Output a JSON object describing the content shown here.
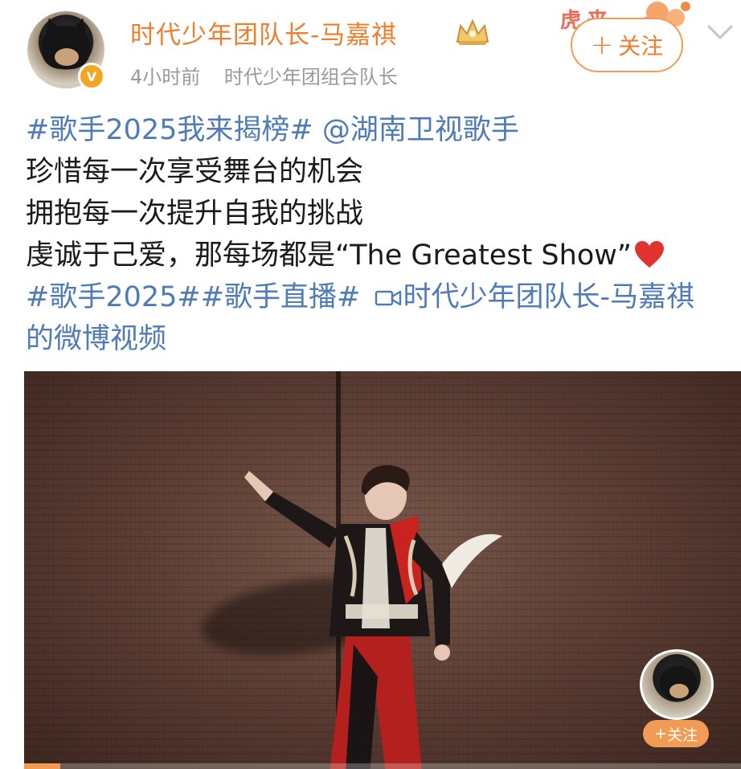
{
  "post": {
    "author": {
      "name": "时代少年团队长-马嘉祺",
      "verified": true
    },
    "meta": {
      "time": "4小时前",
      "title": "时代少年团组合队长"
    },
    "follow_label": "关注",
    "content": {
      "line1": {
        "hashtag": "#歌手2025我来揭榜#",
        "mention": "@湖南卫视歌手"
      },
      "line2": "珍惜每一次享受舞台的机会",
      "line3": "拥抱每一次提升自我的挑战",
      "line4": "虔诚于己爱，那每场都是“The Greatest Show”",
      "line5": {
        "hashtag1": "#歌手2025#",
        "hashtag2": "#歌手直播#",
        "video_link": "时代少年团队长-马嘉祺"
      },
      "line6": "的微博视频"
    },
    "video": {
      "follow_label": "关注",
      "progress": 0.05
    }
  },
  "colors": {
    "accent": "#ef7e2c",
    "link": "#4f7bb6",
    "meta": "#9a9a9a"
  },
  "icons": [
    "verified-icon",
    "crown-icon",
    "chevron-down-icon",
    "heart-icon",
    "video-cam-icon"
  ]
}
